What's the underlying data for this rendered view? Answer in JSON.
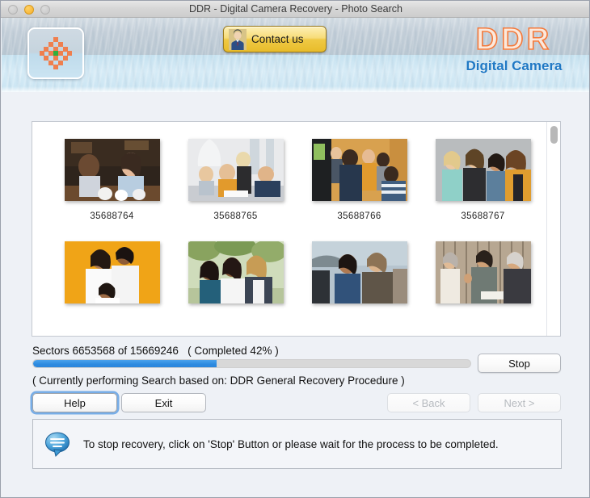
{
  "window": {
    "title": "DDR - Digital Camera Recovery - Photo Search",
    "traffic_lights": [
      "close",
      "minimize",
      "zoom"
    ]
  },
  "header": {
    "app_icon_name": "ddr-app-icon",
    "contact_button_label": "Contact us",
    "logo_main": "DDR",
    "logo_sub": "Digital Camera",
    "logo_main_color": "#f4793a",
    "logo_sub_color": "#1f78c4"
  },
  "thumbnails": {
    "rows": [
      [
        {
          "label": "35688764"
        },
        {
          "label": "35688765"
        },
        {
          "label": "35688766"
        },
        {
          "label": "35688767"
        }
      ],
      [
        {
          "label": ""
        },
        {
          "label": ""
        },
        {
          "label": ""
        },
        {
          "label": ""
        }
      ]
    ]
  },
  "progress": {
    "status_text": "Sectors 6653568 of 15669246   ( Completed 42% )",
    "sectors_done": 6653568,
    "sectors_total": 15669246,
    "percent": 42,
    "fill_color": "#2c8ae0",
    "track_color": "#d8d8d8",
    "stop_label": "Stop",
    "currently_text": "( Currently performing Search based on: DDR General Recovery Procedure )"
  },
  "buttons": {
    "help": "Help",
    "exit": "Exit",
    "back": "< Back",
    "next": "Next >"
  },
  "info": {
    "icon_name": "speech-bubble-icon",
    "message": "To stop recovery, click on 'Stop' Button or please wait for the process to be completed."
  }
}
